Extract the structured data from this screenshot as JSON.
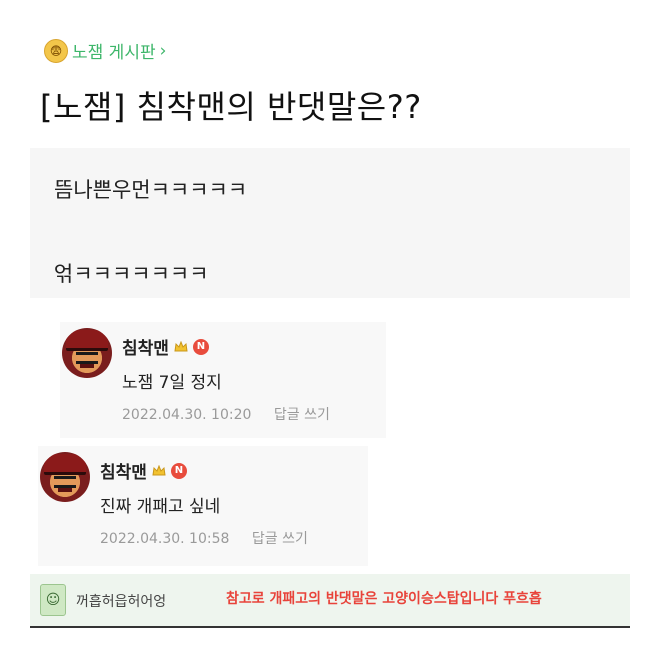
{
  "board": {
    "icon": "scared-face-icon",
    "label": "노잼 게시판",
    "chevron": "›"
  },
  "post": {
    "title": "[노잼] 침착맨의 반댓말은??",
    "lines": [
      "뜸나쁜우먼ㅋㅋㅋㅋㅋ",
      "얶ㅋㅋㅋㅋㅋㅋㅋ"
    ]
  },
  "comments": [
    {
      "author": "침착맨",
      "badge": "N",
      "text": "노잼 7일 정지",
      "date": "2022.04.30. 10:20",
      "reply": "답글 쓰기"
    },
    {
      "author": "침착맨",
      "badge": "N",
      "text": "진짜 개패고 싶네",
      "date": "2022.04.30. 10:58",
      "reply": "답글 쓰기"
    }
  ],
  "banner": {
    "nickname": "꺼흡허읍허어엉",
    "note": "참고로 개패고의 반댓말은 고양이승스탑입니다 푸흐흡"
  },
  "colors": {
    "board_green": "#3db66a",
    "badge_red": "#e84c3d",
    "note_red": "#e8433a"
  }
}
